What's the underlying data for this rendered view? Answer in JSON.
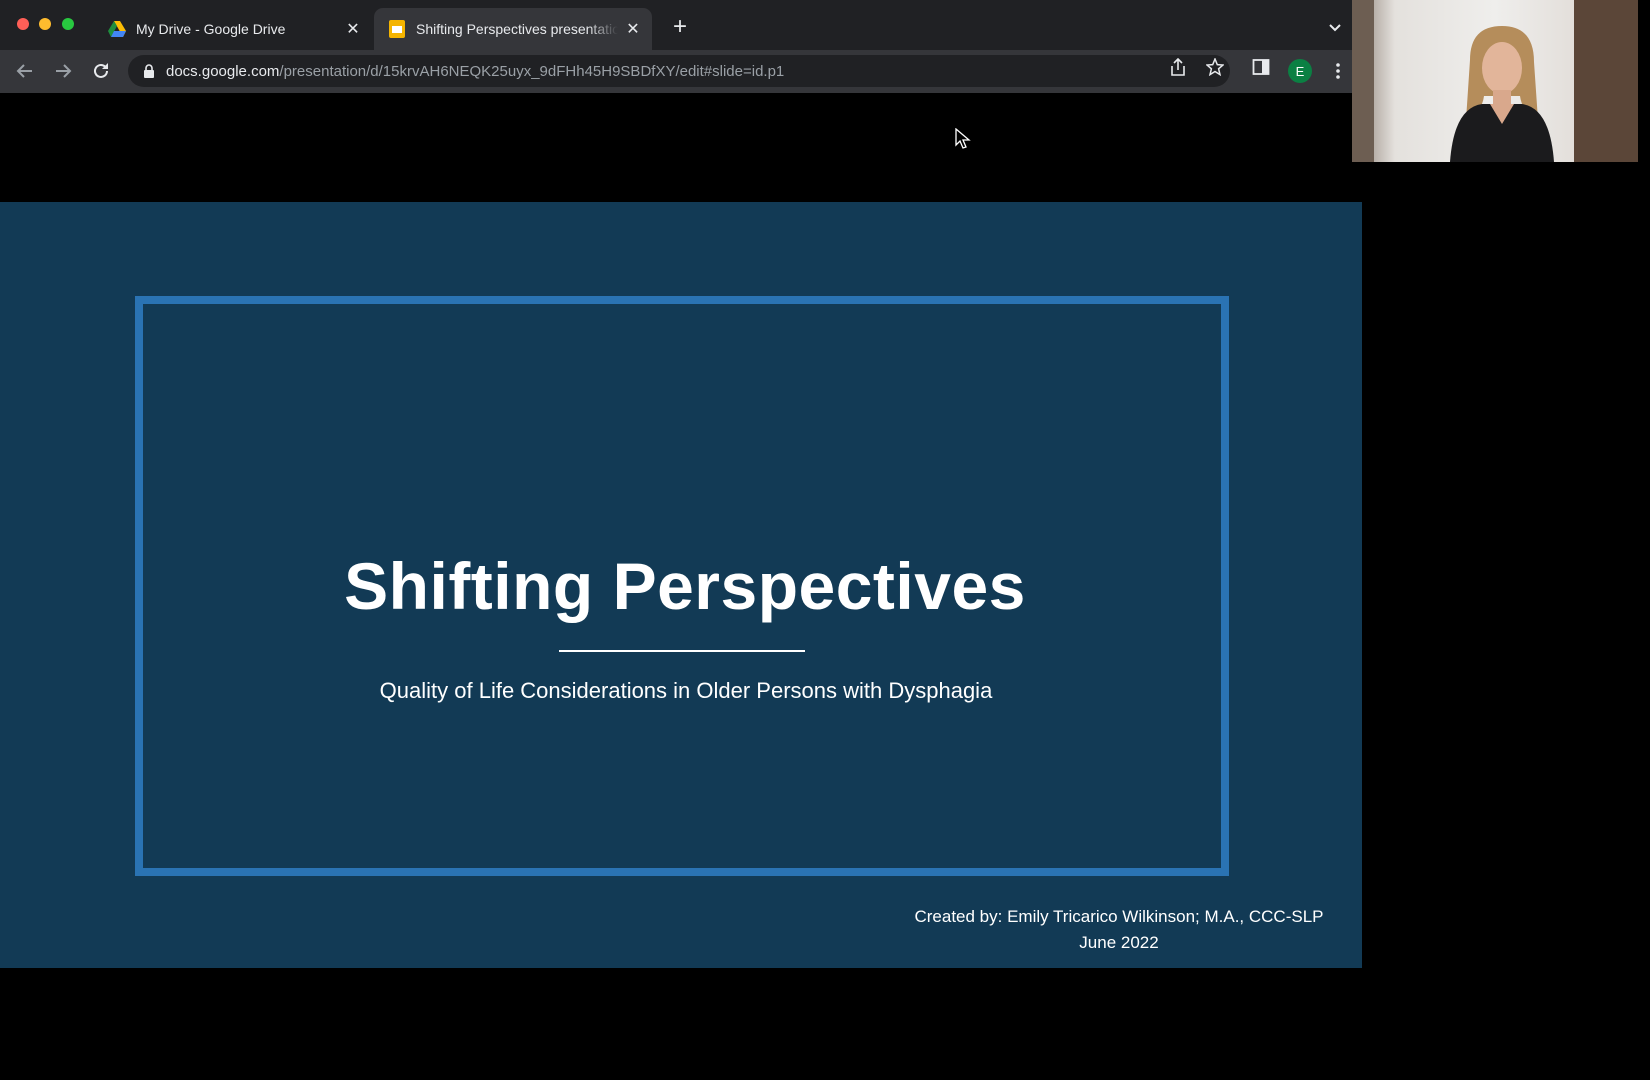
{
  "browser": {
    "tabs": [
      {
        "label": "My Drive - Google Drive",
        "icon": "google-drive-icon",
        "active": false
      },
      {
        "label": "Shifting Perspectives presentation",
        "icon": "google-slides-icon",
        "active": true
      }
    ],
    "url_host": "docs.google.com",
    "url_path": "/presentation/d/15krvAH6NEQK25uyx_9dFHh45H9SBDfXY/edit#slide=id.p1",
    "profile_initial": "E",
    "colors": {
      "chrome_dark": "#202124",
      "toolbar": "#35363a",
      "profile": "#0b8043"
    }
  },
  "slide": {
    "title": "Shifting Perspectives",
    "subtitle": "Quality of Life Considerations in Older Persons with Dysphagia",
    "credit_line1": "Created by: Emily Tricarico Wilkinson; M.A., CCC-SLP",
    "credit_line2": "June 2022",
    "colors": {
      "background": "#123a55",
      "frame": "#2a73b3",
      "text": "#ffffff"
    }
  }
}
